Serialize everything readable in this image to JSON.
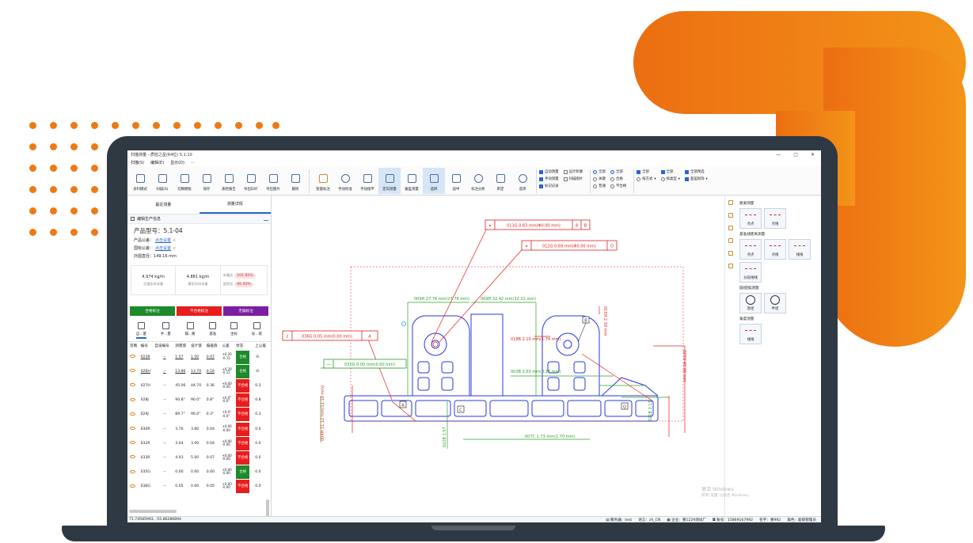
{
  "colors": {
    "orange": "#ec6e12",
    "laptop": "#2f3943",
    "accent": "#2a66c8",
    "pass": "#1e8a2a",
    "fail": "#e81e1e",
    "noLabel": "#7b1fa2"
  },
  "window": {
    "title": "扫描测量 - 质检之星(64位) 5.1.10",
    "minimize": "—",
    "maximize": "▢",
    "close": "✕"
  },
  "menu": [
    "扫描(S)",
    "编辑(E)",
    "显示(D)",
    "..."
  ],
  "ribbon": {
    "buttons": [
      "多料模式",
      "扫描(S)",
      "切换模板",
      "保存",
      "质检报告",
      "导出DXF",
      "导出图片",
      "删除",
      "智能标注",
      "手动校准",
      "手动摆平",
      "定向测量",
      "偏差测量",
      "选择",
      "居中",
      "标注分析",
      "审定",
      "选项"
    ],
    "options_a": [
      {
        "label": "自动测量",
        "checked": true
      },
      {
        "label": "手动测量",
        "checked": true
      },
      {
        "label": "标记记录",
        "checked": true
      }
    ],
    "options_b": [
      {
        "label": "设计轮廓",
        "checked": false
      },
      {
        "label": "扫描图片",
        "checked": false
      }
    ],
    "radios_a": [
      {
        "label": "全部",
        "on": true
      },
      {
        "label": "关键",
        "on": false
      },
      {
        "label": "普通",
        "on": false
      }
    ],
    "radios_b": [
      {
        "label": "全部",
        "on": true
      },
      {
        "label": "合格",
        "on": false
      },
      {
        "label": "不合格",
        "on": false
      }
    ],
    "group_c": {
      "check": "全部",
      "sel": "按方式"
    },
    "group_d": {
      "check": "全部",
      "sel": "按类型"
    },
    "group_e": {
      "check": "全部预选",
      "sel": "超差粉饰"
    }
  },
  "left": {
    "tabs": [
      "最近测量",
      "测量详情"
    ],
    "info_header": "编辑生产信息",
    "model_label": "产品型号：",
    "model": "5.1-04",
    "tol1_label": "产品公差：",
    "tol1_link": "点击设置",
    "tol2_label": "国标公差：",
    "tol2_link": "点击设置",
    "perimeter_label": "外圆直径：",
    "perimeter": "149.16 mm",
    "stat1_value": "4.974 kg/m",
    "stat1_label": "扫描实时米重",
    "stat2_value": "4.881 kg/m",
    "stat2_label": "模型实时米重",
    "ratio1_label": "米重比",
    "ratio1_value": "101.91%",
    "ratio2_label": "面积比",
    "ratio2_value": "95.95%",
    "label_buttons": [
      "合格标注",
      "不合格标注",
      "无偏标注"
    ],
    "tools": [
      "自...量",
      "手...量",
      "辅...要",
      "基准",
      "坐标",
      "标...裹"
    ],
    "columns": [
      "忽略",
      "编号",
      "自设编号",
      "测量值",
      "设计值",
      "偏差值",
      "公差",
      "状态",
      "上公差"
    ],
    "rows": [
      {
        "id": "022B",
        "custom": "--",
        "meas": "1.57",
        "design": "1.50",
        "dev": "0.07",
        "tol_up": "+0.20",
        "tol_dn": "-0.15",
        "status": "合格",
        "pass": true,
        "up": "-0."
      },
      {
        "id": "026H",
        "custom": "--",
        "meas": "13.86",
        "design": "13.70",
        "dev": "0.16",
        "tol_up": "+0.20",
        "tol_dn": "-0.15",
        "status": "合格",
        "pass": true,
        "up": "-0."
      },
      {
        "id": "027H",
        "custom": "--",
        "meas": "45.06",
        "design": "44.70",
        "dev": "0.36",
        "tol_up": "+0.00",
        "tol_dn": "-0.00",
        "status": "不合格",
        "pass": false,
        "up": "0.3"
      },
      {
        "id": "028J",
        "custom": "--",
        "meas": "90.8°",
        "design": "90.0°",
        "dev": "0.8°",
        "tol_up": "+0.0°",
        "tol_dn": "-0.0°",
        "status": "不合格",
        "pass": false,
        "up": "0.8"
      },
      {
        "id": "029J",
        "custom": "--",
        "meas": "89.7°",
        "design": "90.0°",
        "dev": "0.3°",
        "tol_up": "+0.0°",
        "tol_dn": "-0.0°",
        "status": "不合格",
        "pass": false,
        "up": "0.3"
      },
      {
        "id": "030R",
        "custom": "--",
        "meas": "3.76",
        "design": "3.80",
        "dev": "0.04",
        "tol_up": "+0.00",
        "tol_dn": "-0.00",
        "status": "不合格",
        "pass": false,
        "up": "0.0"
      },
      {
        "id": "032R",
        "custom": "--",
        "meas": "3.04",
        "design": "3.00",
        "dev": "0.04",
        "tol_up": "+0.00",
        "tol_dn": "-0.00",
        "status": "不合格",
        "pass": false,
        "up": "0.0"
      },
      {
        "id": "033R",
        "custom": "--",
        "meas": "4.93",
        "design": "5.00",
        "dev": "0.07",
        "tol_up": "+0.00",
        "tol_dn": "-0.00",
        "status": "不合格",
        "pass": false,
        "up": "0.0"
      },
      {
        "id": "035G",
        "custom": "--",
        "meas": "0.00",
        "design": "0.00",
        "dev": "0.00",
        "tol_up": "+0.00",
        "tol_dn": "-0.00",
        "status": "合格",
        "pass": true,
        "up": "0.0"
      },
      {
        "id": "036G",
        "custom": "--",
        "meas": "0.05",
        "design": "0.00",
        "dev": "0.05",
        "tol_up": "+0.00",
        "tol_dn": "-0.00",
        "status": "不合格",
        "pass": false,
        "up": "0.0"
      }
    ]
  },
  "canvas": {
    "fcf1": {
      "text": "011G 0.83 mm(Φ0.00 mm)",
      "d1": "A",
      "d2": "B"
    },
    "fcf2": {
      "text": "012G 0.69 mm(Φ0.00 mm)",
      "d1": "D"
    },
    "fcf3": {
      "text": "036G 0.05 mm(0.00 mm)",
      "d1": "A"
    },
    "fcf4": {
      "text": "035G 0.00 mm(0.00 mm)"
    },
    "dim_top1": "009H 27.78 mm(27.76 mm)",
    "dim_top2": "009H 32.42 mm(32.22 mm)",
    "dim_r": "018B 2.10 mm(1.74 mm)",
    "dim_mid": "003B 3.50 mm(3.28 mm)",
    "dim_bottom": "007C 1.73 mm(1.70 mm)",
    "dim_left": "004H 11.12 mm(11.10 mm)",
    "dim_left2": "022B 1.57",
    "dim_right1": "015H 2.39 mm",
    "dim_right2": "021B 2.13",
    "dim_right3": "025H 45.06 mm",
    "tag_b": "B",
    "tag_a": "A",
    "tag_c": "C",
    "tag_q": "Q"
  },
  "right": {
    "sec1": "距离测量",
    "sec1_btns": [
      "点点",
      "点线"
    ],
    "sec2": "基准线距离测量",
    "sec2_btns": [
      "点点",
      "点线",
      "线线",
      "分段线线"
    ],
    "sec3": "圆/圆弧测量",
    "sec3_btns": [
      "直径",
      "半径"
    ],
    "sec4": "角度测量",
    "sec4_btns": [
      "线线"
    ]
  },
  "status": {
    "coords": "71.74585993, -55.86286894",
    "server_label": "服务器：",
    "server": "test",
    "lang_label": "语言：",
    "lang": "zh_CN",
    "company_label": "企业：",
    "company": "重1229测试厂",
    "account_label": "账号：",
    "account": "15869167992",
    "name_label": "名字：",
    "name": "重992",
    "role_label": "角色：",
    "role": "超级管理员"
  },
  "watermark": {
    "line1": "激活 Windows",
    "line2": "转到\"设置\"以激活 Windows。"
  }
}
